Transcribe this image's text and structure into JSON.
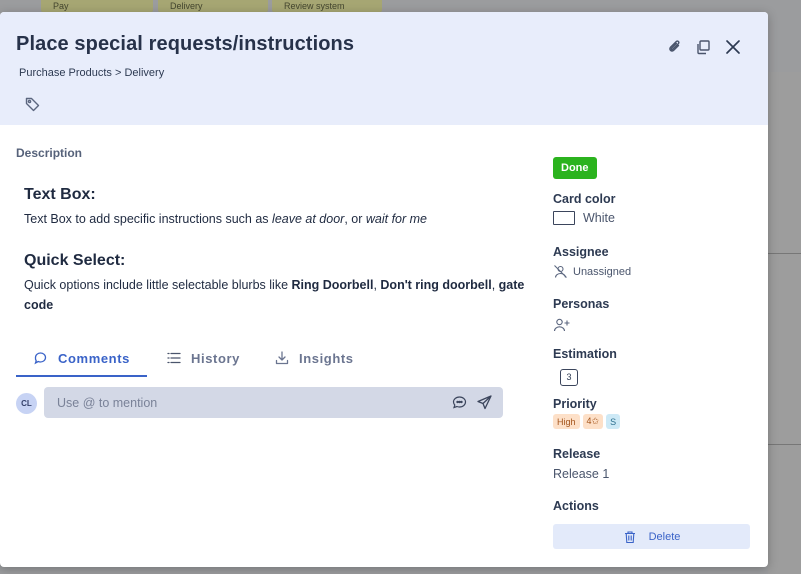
{
  "board": {
    "cards": [
      "Pay",
      "Delivery",
      "Review system"
    ]
  },
  "modal": {
    "title": "Place special requests/instructions",
    "breadcrumb": "Purchase Products > Delivery",
    "header_icons": [
      "paperclip-icon",
      "copy-icon",
      "close-icon"
    ],
    "tag_icon": "tag-icon"
  },
  "description": {
    "label": "Description",
    "section1": {
      "heading": "Text Box:",
      "text_a": "Text Box to add specific instructions such as ",
      "italic1": "leave at door",
      "text_b": ", or ",
      "italic2": "wait for me"
    },
    "section2": {
      "heading": "Quick Select:",
      "text_a": "Quick options include little selectable blurbs like ",
      "bold1": "Ring Doorbell",
      "sep1": ", ",
      "bold2": "Don't ring doorbell",
      "sep2": ", ",
      "bold3": "gate code"
    }
  },
  "tabs": [
    {
      "label": "Comments",
      "icon": "comments-icon",
      "active": true
    },
    {
      "label": "History",
      "icon": "list-icon",
      "active": false
    },
    {
      "label": "Insights",
      "icon": "download-icon",
      "active": false
    }
  ],
  "comment": {
    "avatar_initials": "CL",
    "placeholder": "Use @ to mention"
  },
  "sidebar": {
    "status": "Done",
    "status_color": "#2bb31e",
    "card_color_label": "Card color",
    "card_color_value": "White",
    "assignee_label": "Assignee",
    "assignee_value": "Unassigned",
    "personas_label": "Personas",
    "estimation_label": "Estimation",
    "estimation_value": "3",
    "priority_label": "Priority",
    "priority_chips": [
      {
        "text": "High",
        "bg": "#fde0c8",
        "fg": "#a4541b"
      },
      {
        "text": "4✩",
        "bg": "#fde0c8",
        "fg": "#a4541b"
      },
      {
        "text": "S",
        "bg": "#cde9f6",
        "fg": "#2b6f8e"
      }
    ],
    "release_label": "Release",
    "release_value": "Release 1",
    "actions_label": "Actions",
    "delete_label": "Delete"
  }
}
